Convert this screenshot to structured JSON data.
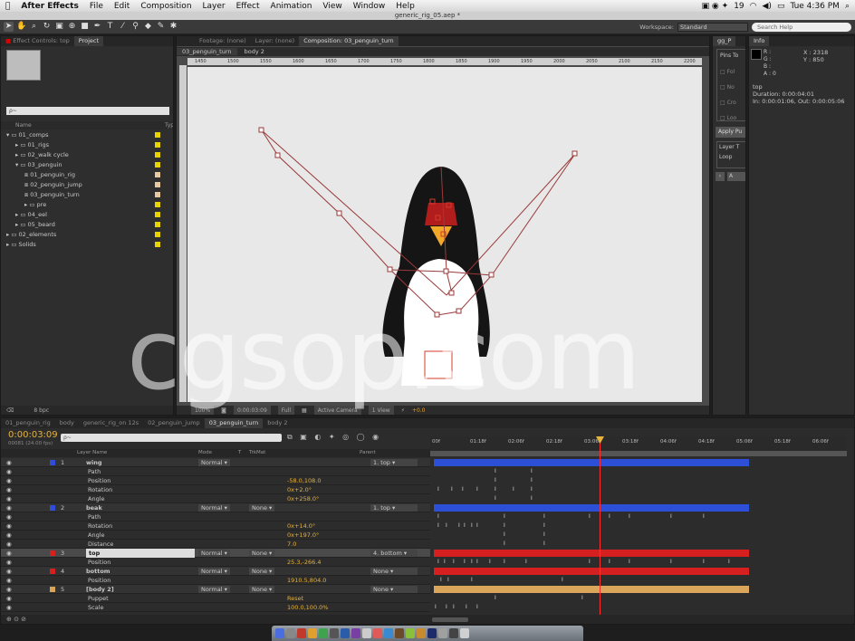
{
  "menubar": {
    "app": "After Effects",
    "items": [
      "File",
      "Edit",
      "Composition",
      "Layer",
      "Effect",
      "Animation",
      "View",
      "Window",
      "Help"
    ],
    "status_num": "19",
    "clock": "Tue 4:36 PM"
  },
  "window_title": "generic_rig_05.aep *",
  "workspace": {
    "label": "Workspace:",
    "value": "Standard",
    "search": "Search Help"
  },
  "project_panel": {
    "tabs": [
      "Effect Controls: top",
      "Project"
    ],
    "search_placeholder": "ρ~",
    "col_name": "Name",
    "col_type": "Typ",
    "items": [
      {
        "label": "01_comps",
        "depth": 0,
        "color": "#e8d300",
        "folder": true,
        "open": true
      },
      {
        "label": "01_rigs",
        "depth": 1,
        "color": "#e8d300",
        "folder": true,
        "open": false
      },
      {
        "label": "02_walk cycle",
        "depth": 1,
        "color": "#e8d300",
        "folder": true,
        "open": false
      },
      {
        "label": "03_penguin",
        "depth": 1,
        "color": "#e8d300",
        "folder": true,
        "open": true
      },
      {
        "label": "01_penguin_rig",
        "depth": 2,
        "color": "#e8c8a0",
        "folder": false
      },
      {
        "label": "02_penguin_jump",
        "depth": 2,
        "color": "#e8c8a0",
        "folder": false
      },
      {
        "label": "03_penguin_turn",
        "depth": 2,
        "color": "#e8c8a0",
        "folder": false
      },
      {
        "label": "pre",
        "depth": 2,
        "color": "#e8d300",
        "folder": true,
        "open": false
      },
      {
        "label": "04_eel",
        "depth": 1,
        "color": "#e8d300",
        "folder": true,
        "open": false
      },
      {
        "label": "05_beard",
        "depth": 1,
        "color": "#e8d300",
        "folder": true,
        "open": false
      },
      {
        "label": "02_elements",
        "depth": 0,
        "color": "#e8d300",
        "folder": true,
        "open": false
      },
      {
        "label": "Solids",
        "depth": 0,
        "color": "#e8d300",
        "folder": true,
        "open": false
      }
    ],
    "bpc": "8 bpc"
  },
  "viewer": {
    "tabs": [
      "Footage: (none)",
      "Layer: (none)",
      "Composition: 03_penguin_turn"
    ],
    "breadcrumbs": [
      "03_penguin_turn",
      "body 2"
    ],
    "ruler": [
      "1450",
      "1500",
      "1550",
      "1600",
      "1650",
      "1700",
      "1750",
      "1800",
      "1850",
      "1900",
      "1950",
      "2000",
      "2050",
      "2100",
      "2150",
      "2200"
    ],
    "zoom": "100%",
    "time": "0:00:03:09",
    "resolution": "Full",
    "camera": "Active Camera",
    "view": "1 View",
    "exposure": "+0.0"
  },
  "side_panel": {
    "tab": "gg_P",
    "pins_label": "Pins To",
    "checks": [
      "Fol",
      "No",
      "Cro",
      "Loo"
    ],
    "apply": "Apply Pu",
    "layer_t": "Layer T",
    "loop": "Loop"
  },
  "info_panel": {
    "tab": "Info",
    "r": "R :",
    "g": "G :",
    "b": "B :",
    "a": "A : 0",
    "x": "X : 2318",
    "y": "Y : 850",
    "layer": "top",
    "duration": "Duration: 0:00:04:01",
    "inout": "In: 0:00:01:06, Out: 0:00:05:06"
  },
  "timeline_tabs": [
    "01_penguin_rig",
    "body",
    "generic_rig_on 12s",
    "02_penguin_jump",
    "03_penguin_turn",
    "body 2"
  ],
  "timeline": {
    "time": "0:00:03:09",
    "frames": "00081 (24.00 fps)",
    "col_layer": "Layer Name",
    "col_mode": "Mode",
    "col_t": "T",
    "col_trkmat": "TrkMat",
    "col_parent": "Parent",
    "ruler": [
      "00f",
      "01:18f",
      "02:06f",
      "02:18f",
      "03:06f",
      "03:18f",
      "04:06f",
      "04:18f",
      "05:06f",
      "05:18f",
      "06:06f"
    ],
    "rows": [
      {
        "num": "1",
        "name": "wing",
        "type": "layer",
        "color": "#2d4ed6",
        "mode": "Normal",
        "trk": "",
        "parent": "1. top",
        "value": ""
      },
      {
        "name": "Path",
        "type": "prop",
        "value": ""
      },
      {
        "name": "Position",
        "type": "prop",
        "value": "-58.0,108.0"
      },
      {
        "name": "Rotation",
        "type": "prop",
        "value": "0x+2.0°"
      },
      {
        "name": "Angle",
        "type": "prop",
        "value": "0x+258.0°"
      },
      {
        "num": "2",
        "name": "beak",
        "type": "layer",
        "color": "#2d4ed6",
        "mode": "Normal",
        "trk": "None",
        "parent": "1. top",
        "value": ""
      },
      {
        "name": "Path",
        "type": "prop",
        "value": ""
      },
      {
        "name": "Rotation",
        "type": "prop",
        "value": "0x+14.0°"
      },
      {
        "name": "Angle",
        "type": "prop",
        "value": "0x+197.0°"
      },
      {
        "name": "Distance",
        "type": "prop",
        "value": "7.0"
      },
      {
        "num": "3",
        "name": "top",
        "type": "layer",
        "color": "#d62020",
        "mode": "Normal",
        "trk": "None",
        "parent": "4. bottom",
        "value": "",
        "selected": true
      },
      {
        "name": "Position",
        "type": "prop",
        "value": "25.3,-266.4"
      },
      {
        "num": "4",
        "name": "bottom",
        "type": "layer",
        "color": "#d62020",
        "mode": "Normal",
        "trk": "None",
        "parent": "None",
        "value": ""
      },
      {
        "name": "Position",
        "type": "prop",
        "value": "1910.5,804.0"
      },
      {
        "num": "5",
        "name": "[body 2]",
        "type": "layer",
        "color": "#d9a55a",
        "mode": "Normal",
        "trk": "None",
        "parent": "None",
        "value": ""
      },
      {
        "name": "Puppet",
        "type": "prop",
        "value": "Reset"
      },
      {
        "name": "Scale",
        "type": "prop",
        "value": "100.0,100.0%"
      }
    ]
  },
  "watermark": "cgsop.com"
}
